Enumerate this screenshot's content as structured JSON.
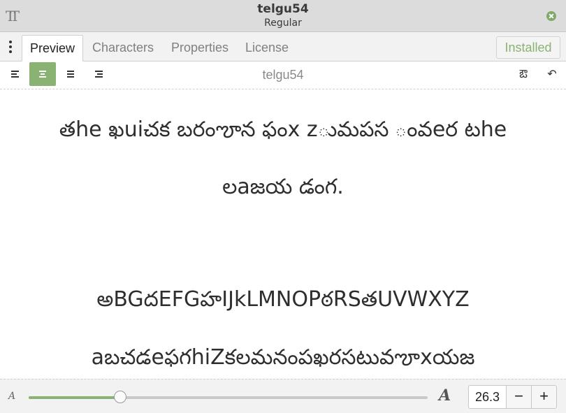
{
  "window": {
    "title": "telgu54",
    "subtitle": "Regular",
    "app_icon_glyph": "TT"
  },
  "tabs": [
    {
      "label": "Preview",
      "active": true
    },
    {
      "label": "Characters",
      "active": false
    },
    {
      "label": "Properties",
      "active": false
    },
    {
      "label": "License",
      "active": false
    }
  ],
  "install_button": {
    "label": "Installed"
  },
  "toolbar": {
    "font_name": "telgu54",
    "alignment": [
      "left",
      "center",
      "fill",
      "right"
    ],
    "active_alignment": "center",
    "icons": {
      "format": "text-direction-icon",
      "undo": "undo-icon"
    }
  },
  "preview": {
    "line1": "తhe ఖuiచక బరంౡన ఫంx zుమపస ంవeర టhe",
    "line2": "లaజయ డంగ.",
    "uppercase": "అBGదEFGహIJkLMNOPఠRSతUVWXYZ",
    "lowercase": "aబచడeఫగhiZకలమనంపఖరసటువౡxయజ"
  },
  "size_control": {
    "value": "26.3",
    "slider_fraction": 0.23,
    "minus": "−",
    "plus": "+"
  },
  "colors": {
    "accent": "#8ab273",
    "titlebar": "#dcdcdc"
  }
}
